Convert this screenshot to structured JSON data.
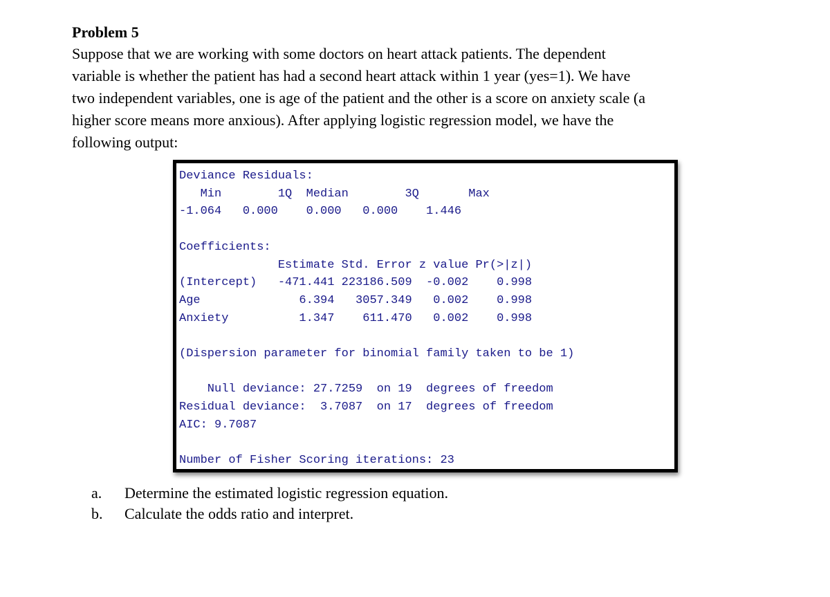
{
  "problem": {
    "title": "Problem 5",
    "lines": [
      "Suppose that we are working with some doctors on heart attack patients. The dependent",
      "variable is whether the patient has had a second heart attack within 1 year (yes=1). We have",
      "two independent variables, one is age of the patient and the other is a score on anxiety scale (a",
      "higher score means more anxious). After applying logistic regression model, we have the",
      "following output:"
    ]
  },
  "output": {
    "deviance_header": "Deviance Residuals:",
    "deviance_cols": "   Min        1Q  Median        3Q       Max",
    "deviance_vals": "-1.064   0.000    0.000   0.000    1.446",
    "deviance_residuals": {
      "Min": "-1.064",
      "1Q": "0.000",
      "Median": "0.000",
      "3Q": "0.000",
      "Max": "1.446"
    },
    "coef_header": "Coefficients:",
    "coef_cols": "              Estimate Std. Error z value Pr(>|z|)",
    "coef_rows": [
      "(Intercept)   -471.441 223186.509  -0.002    0.998",
      "Age              6.394   3057.349   0.002    0.998",
      "Anxiety          1.347    611.470   0.002    0.998"
    ],
    "coefficients": [
      {
        "term": "(Intercept)",
        "estimate": "-471.441",
        "std_error": "223186.509",
        "z_value": "-0.002",
        "p_value": "0.998"
      },
      {
        "term": "Age",
        "estimate": "6.394",
        "std_error": "3057.349",
        "z_value": "0.002",
        "p_value": "0.998"
      },
      {
        "term": "Anxiety",
        "estimate": "1.347",
        "std_error": "611.470",
        "z_value": "0.002",
        "p_value": "0.998"
      }
    ],
    "dispersion": "(Dispersion parameter for binomial family taken to be 1)",
    "null_deviance": "    Null deviance: 27.7259  on 19  degrees of freedom",
    "residual_deviance": "Residual deviance:  3.7087  on 17  degrees of freedom",
    "aic": "AIC: 9.7087",
    "fisher": "Number of Fisher Scoring iterations: 23"
  },
  "questions": [
    {
      "label": "a.",
      "text": "Determine the estimated logistic regression equation."
    },
    {
      "label": "b.",
      "text": "Calculate the odds ratio and interpret."
    }
  ]
}
